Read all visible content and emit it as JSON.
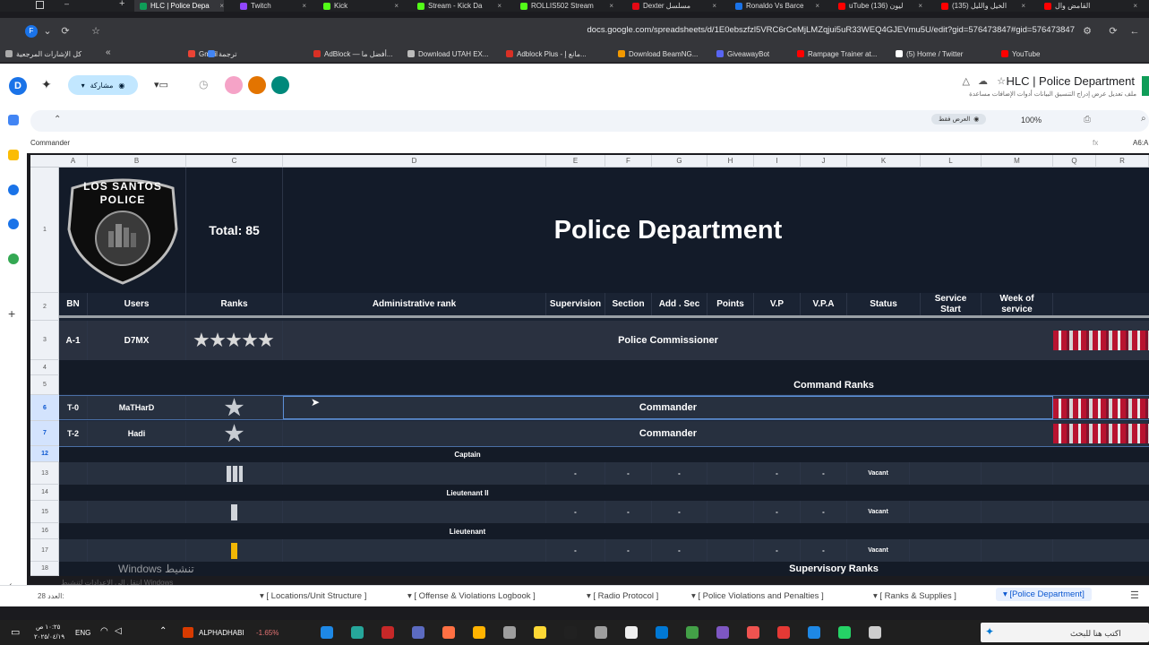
{
  "browser": {
    "tabs": [
      {
        "label": "HLC | Police Depa",
        "color": "#0f9d58",
        "active": true
      },
      {
        "label": "Twitch",
        "color": "#9146ff",
        "active": false
      },
      {
        "label": "Kick",
        "color": "#53fc18",
        "active": false
      },
      {
        "label": "Stream - Kick Da",
        "color": "#53fc18",
        "active": false
      },
      {
        "label": "ROLLIS502 Stream",
        "color": "#53fc18",
        "active": false
      },
      {
        "label": "Dexter مسلسل",
        "color": "#e50914",
        "active": false
      },
      {
        "label": "Ronaldo Vs Barce",
        "color": "#1a73e8",
        "active": false
      },
      {
        "label": "uTube (136) ليون",
        "color": "#ff0000",
        "active": false
      },
      {
        "label": "(135) الخيل والليل",
        "color": "#ff0000",
        "active": false
      },
      {
        "label": "القامض وال",
        "color": "#ff0000",
        "active": false
      }
    ],
    "url": "docs.google.com/spreadsheets/d/1E0ebszfzl5VRC6rCeMjLMZqjui5uR33WEQ4GJEVmu5U/edit?gid=576473847#gid=576473847",
    "bookmarks": [
      {
        "label": "كل الإشارات المرجعية",
        "color": "#aaaaaa"
      },
      {
        "label": "Gmail",
        "color": "#ea4335"
      },
      {
        "label": "ترجمة",
        "color": "#4285f4"
      },
      {
        "label": "AdBlock — أفضل ما...",
        "color": "#d93025"
      },
      {
        "label": "Download UTAH EX...",
        "color": "#bbbbbb"
      },
      {
        "label": "Adblock Plus - مانع إ...",
        "color": "#d93025"
      },
      {
        "label": "Download BeamNG...",
        "color": "#f29900"
      },
      {
        "label": "GiveawayBot",
        "color": "#5865f2"
      },
      {
        "label": "Rampage Trainer at...",
        "color": "#ff0000"
      },
      {
        "label": "(5) Home / Twitter",
        "color": "#ffffff"
      },
      {
        "label": "YouTube",
        "color": "#ff0000"
      }
    ]
  },
  "sheets": {
    "title": "HLC | Police Department",
    "menus": "ملف   تعديل   عرض   إدراج   التنسيق   البيانات   أدوات   الإضافات   مساعدة",
    "share_label": "مشاركة",
    "zoom": "100%",
    "view_only": "العرض فقط",
    "formula_text": "Commander",
    "name_box": "A6:A",
    "columns": [
      "A",
      "B",
      "C",
      "D",
      "E",
      "F",
      "G",
      "H",
      "I",
      "J",
      "K",
      "L",
      "M",
      "Q",
      "R"
    ],
    "row_numbers": [
      "1",
      "2",
      "3",
      "4",
      "5",
      "6",
      "7",
      "12",
      "13",
      "14",
      "15",
      "16",
      "17",
      "18"
    ]
  },
  "table": {
    "total": "Total: 85",
    "heading": "Police Department",
    "logo_text": "LOS SANTOS POLICE",
    "headers": {
      "bn": "BN",
      "users": "Users",
      "ranks": "Ranks",
      "admin_rank": "Administrative rank",
      "supervision": "Supervision",
      "section": "Section",
      "add_sec": "Add . Sec",
      "points": "Points",
      "vp": "V.P",
      "vpa": "V.P.A",
      "status": "Status",
      "service_start": "Service Start",
      "week": "Week of service"
    },
    "commissioner": {
      "bn": "A-1",
      "user": "D7MX",
      "stars": "★★★★★",
      "rank": "Police Commissioner"
    },
    "command_ranks_title": "Command Ranks",
    "commanders": [
      {
        "bn": "T-0",
        "user": "MaTHarD",
        "rank": "Commander"
      },
      {
        "bn": "T-2",
        "user": "Hadi",
        "rank": "Commander"
      }
    ],
    "captain_title": "Captain",
    "lieutenant2_title": "Lieutenant II",
    "lieutenant_title": "Lieutenant",
    "vacant": "Vacant",
    "dash": "-",
    "supervisory_title": "Supervisory Ranks"
  },
  "bottom": {
    "sheet_count": "28 العدد:",
    "tabs": [
      "[ Locations/Unit Structure ]",
      "[ Offense & Violations Logbook ]",
      "[ Radio Protocol ]",
      "[ Police Violations and Penalties ]",
      "[ Ranks & Supplies ]",
      "[Police Department]"
    ],
    "watermark": "Windows تنشيط",
    "watermark_sub": "انتقل إلى الإعدادات لتنشيط Windows"
  },
  "taskbar": {
    "stock_label": "ALPHADHABI",
    "stock_value": "-1.65%",
    "lang": "ENG",
    "time": "١٠:٢٥ ص",
    "date": "٢٠٢٥/٠٤/١٩",
    "search_placeholder": "اكتب هنا للبحث"
  }
}
